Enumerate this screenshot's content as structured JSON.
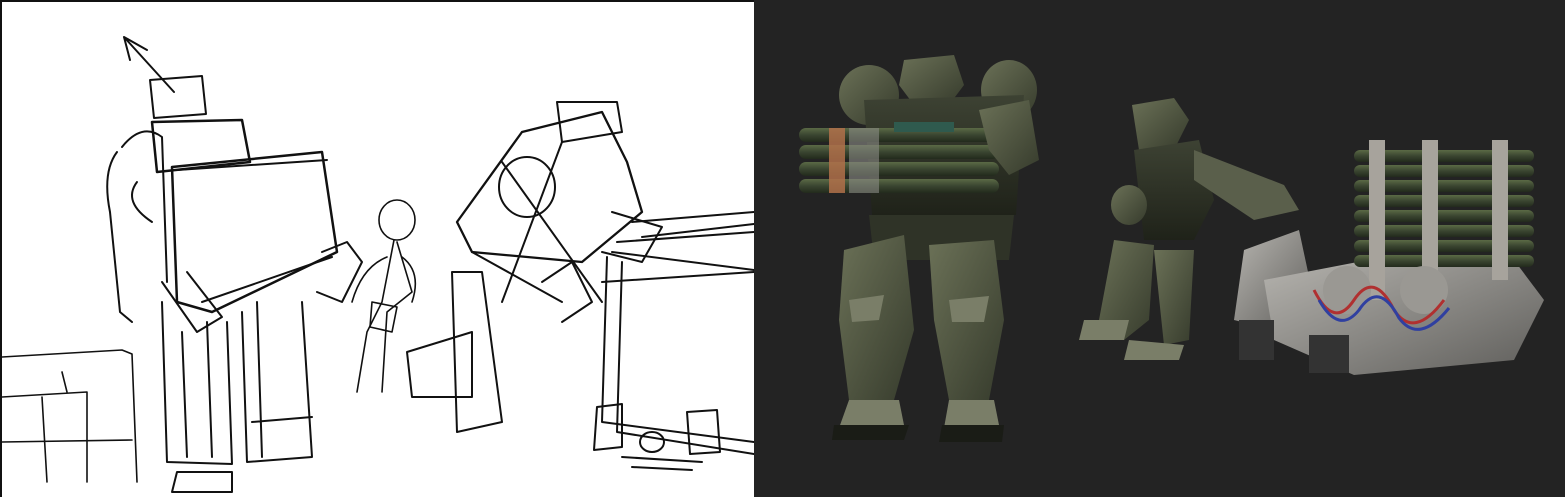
{
  "panels": {
    "sketch": {
      "background": "#ffffff",
      "line_color": "#111111"
    },
    "render": {
      "background": "#232323",
      "armor_color": "#4e5440",
      "accent_green": "#3f4a35",
      "metal_color": "#8a8a86",
      "copper_color": "#b0704a",
      "cable_red": "#b03030",
      "cable_blue": "#3040a0"
    }
  },
  "figures": [
    {
      "id": "mech-carrying-crate",
      "description_icon": "mech-icon"
    },
    {
      "id": "human-figure",
      "description_icon": "person-icon"
    },
    {
      "id": "mech-pushing-cart",
      "description_icon": "mech-icon"
    },
    {
      "id": "ammo-cart",
      "description_icon": "cart-icon"
    }
  ]
}
